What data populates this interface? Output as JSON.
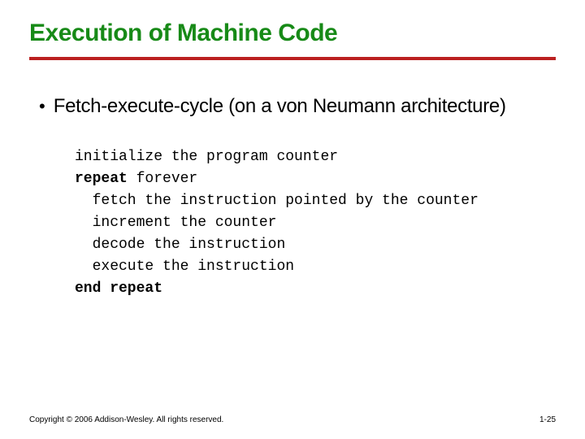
{
  "title": "Execution of Machine Code",
  "bullet": "Fetch-execute-cycle (on a von Neumann architecture)",
  "code": {
    "l1": "initialize the program counter",
    "l2a": "repeat",
    "l2b": " forever",
    "l3": "  fetch the instruction pointed by the counter",
    "l4": "  increment the counter",
    "l5": "  decode the instruction",
    "l6": "  execute the instruction",
    "l7": "end repeat"
  },
  "footer": {
    "copyright": "Copyright © 2006 Addison-Wesley. All rights reserved.",
    "page": "1-25"
  }
}
